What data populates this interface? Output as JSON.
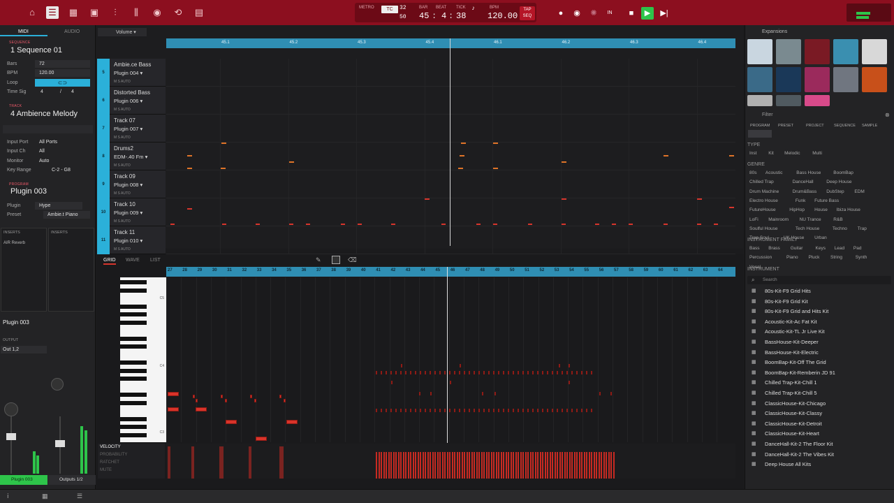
{
  "topbar": {
    "transport": {
      "metro_label": "METRO",
      "tc_label": "TC",
      "tc_value": "32",
      "swing_value": "50",
      "bar_label": "BAR",
      "beat_label": "BEAT",
      "tick_label": "TICK",
      "bar": "45",
      "beat": "4",
      "tick": "38",
      "bpm_label": "BPM",
      "bpm": "120.00",
      "tap_label": "TAP",
      "seq_label": "SEQ"
    }
  },
  "left": {
    "tab_midi": "MIDI",
    "tab_audio": "AUDIO",
    "sequence_head": "SEQUENCE",
    "sequence_name": "1 Sequence 01",
    "bars_label": "Bars",
    "bars_value": "72",
    "bpm_label": "BPM",
    "bpm_value": "120.00",
    "loop_label": "Loop",
    "timesig_label": "Time Sig",
    "timesig_num": "4",
    "timesig_den": "4",
    "track_head": "TRACK",
    "track_name": "4 Ambience Melody",
    "input_port_label": "Input Port",
    "input_port_value": "All Ports",
    "input_ch_label": "Input Ch",
    "input_ch_value": "All",
    "monitor_label": "Monitor",
    "monitor_value": "Auto",
    "key_range_label": "Key Range",
    "key_range_value": "C-2 - G8",
    "program_head": "PROGRAM",
    "program_name": "Plugin 003",
    "plugin_label": "Plugin",
    "plugin_value": "Hype",
    "preset_label": "Preset",
    "preset_value": "Ambie.t Piano",
    "inserts_left": "INSERTS",
    "inserts_right": "INSERTS",
    "insert_1": "AIR Reverb",
    "channel_name": "Plugin 003",
    "output_head": "OUTPUT",
    "output_value": "Out 1,2",
    "strip_left": "Plugin 003",
    "strip_right": "Outputs 1/2"
  },
  "tracks_panel": {
    "volume_label": "Volume",
    "ruler": [
      "45.1",
      "45.2",
      "45.3",
      "45.4",
      "46.1",
      "46.2",
      "46.3",
      "46.4"
    ],
    "tracks": [
      {
        "num": "5",
        "name": "Ambie.ce Bass",
        "plugin": "Plugin 004"
      },
      {
        "num": "6",
        "name": "Distorted Bass",
        "plugin": "Plugin 006"
      },
      {
        "num": "7",
        "name": "Track 07",
        "plugin": "Plugin 007"
      },
      {
        "num": "8",
        "name": "Drums2",
        "plugin": "EDM-.40 Fm"
      },
      {
        "num": "9",
        "name": "Track 09",
        "plugin": "Plugin 008"
      },
      {
        "num": "10",
        "name": "Track 10",
        "plugin": "Plugin 009"
      },
      {
        "num": "11",
        "name": "Track 11",
        "plugin": "Plugin 010"
      }
    ]
  },
  "editor": {
    "tab_grid": "GRID",
    "tab_wave": "WAVE",
    "tab_list": "LIST",
    "bars": [
      "27",
      "28",
      "29",
      "30",
      "31",
      "32",
      "33",
      "34",
      "35",
      "36",
      "37",
      "38",
      "39",
      "40",
      "41",
      "42",
      "43",
      "44",
      "45",
      "46",
      "47",
      "48",
      "49",
      "50",
      "51",
      "52",
      "53",
      "54",
      "55",
      "56",
      "57",
      "58",
      "59",
      "60",
      "61",
      "62",
      "63",
      "64"
    ],
    "lane_velocity": "VELOCITY",
    "lane_probability": "PROBABILITY",
    "lane_ratchet": "RATCHET",
    "lane_mute": "MUTE",
    "key_c5": "C5",
    "key_c4": "C4",
    "key_c3": "C3"
  },
  "right": {
    "expansions_head": "Expansions",
    "filter_head": "Filter",
    "tabs": [
      "PROGRAM",
      "PRESET",
      "PROJECT",
      "SEQUENCE",
      "SAMPLE"
    ],
    "type_head": "TYPE",
    "types": [
      "Inst",
      "Kit",
      "Melodic",
      "Multi"
    ],
    "genre_head": "GENRE",
    "genres": [
      "80s",
      "Acoustic",
      "Bass House",
      "BoomBap",
      "Chilled Trap",
      "DanceHall",
      "Deep House",
      "Drum Machine",
      "Drum&Bass",
      "DubStep",
      "EDM",
      "Electro House",
      "Funk",
      "Future Bass",
      "FutureHouse",
      "HipHop",
      "House",
      "Ibiza House",
      "LoFi",
      "Mainroom",
      "NU Trance",
      "R&B",
      "Soulful House",
      "Tech House",
      "Techno",
      "Trap",
      "Trap Soul",
      "UK House",
      "Urban"
    ],
    "family_head": "INSTRUMENT FAMILY",
    "families": [
      "Bass",
      "Brass",
      "Guitar",
      "Keys",
      "Lead",
      "Pad",
      "Percussion",
      "Piano",
      "Pluck",
      "String",
      "Synth",
      "Vocal"
    ],
    "instrument_head": "INSTRUMENT",
    "search_placeholder": "Search",
    "kits": [
      "80s-Kit-F9 Grid Hits",
      "80s-Kit-F9 Grid Kit",
      "80s-Kit-F9 Grid and Hits Kit",
      "Acoustic-Kit-Ac Fat Kit",
      "Acoustic-Kit-TL Jr Live Kit",
      "BassHouse-Kit-Deeper",
      "BassHouse-Kit-Electric",
      "BoomBap-Kit-Off The Grid",
      "BoomBap-Kit-Remberin JD 91",
      "Chilled Trap-Kit-Chill 1",
      "Chilled Trap-Kit-Chill 5",
      "ClassicHouse-Kit-Chicago",
      "ClassicHouse-Kit-Classy",
      "ClassicHouse-Kit-Detroit",
      "ClassicHouse-Kit-Heart",
      "DanceHall-Kit-2 The Floor Kit",
      "DanceHall-Kit-2 The Vibes Kit",
      "Deep House All Kits"
    ],
    "thumb_colors": [
      "#c9d6e0",
      "#7a8a90",
      "#7a1a24",
      "#3a8fb0",
      "#d8d8d8",
      "#3a6a88",
      "#1a3858",
      "#9b2a5c",
      "#707680",
      "#c8501a",
      "#b0b0b0",
      "#505a60",
      "#d84a8a"
    ]
  }
}
